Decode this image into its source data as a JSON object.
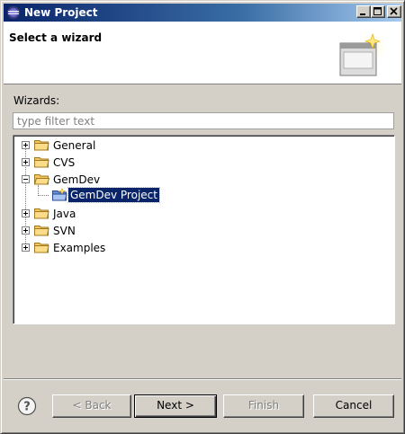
{
  "window": {
    "title": "New Project",
    "controls": {
      "minimize": "minimize",
      "maximize": "maximize",
      "close": "close"
    }
  },
  "banner": {
    "title": "Select a wizard"
  },
  "wizards": {
    "label": "Wizards:",
    "filter_placeholder": "type filter text",
    "filter_value": ""
  },
  "tree": {
    "nodes": [
      {
        "label": "General",
        "expanded": false
      },
      {
        "label": "CVS",
        "expanded": false
      },
      {
        "label": "GemDev",
        "expanded": true,
        "children": [
          {
            "label": "GemDev Project",
            "selected": true
          }
        ]
      },
      {
        "label": "Java",
        "expanded": false
      },
      {
        "label": "SVN",
        "expanded": false
      },
      {
        "label": "Examples",
        "expanded": false
      }
    ]
  },
  "buttons": {
    "help_icon": "question-mark",
    "back": "< Back",
    "next": "Next >",
    "finish": "Finish",
    "cancel": "Cancel"
  },
  "colors": {
    "title_bar": "#0a246a",
    "selection": "#0a246a",
    "dialog_bg": "#d4d0c8",
    "folder": "#f4c660"
  }
}
